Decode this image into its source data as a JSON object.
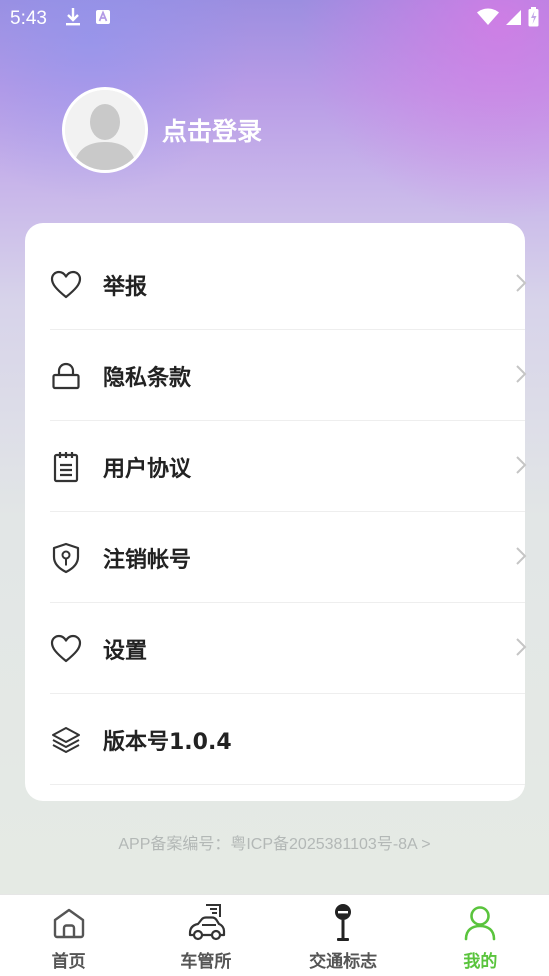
{
  "status_bar": {
    "time": "5:43",
    "left_icons": [
      "download-icon",
      "a-notification-icon"
    ],
    "right_icons": [
      "wifi-icon",
      "signal-icon",
      "battery-charging-icon"
    ]
  },
  "profile": {
    "login_text": "点击登录"
  },
  "menu": {
    "items": [
      {
        "label": "举报",
        "icon": "heart-icon",
        "has_chevron": true
      },
      {
        "label": "隐私条款",
        "icon": "lock-icon",
        "has_chevron": true
      },
      {
        "label": "用户协议",
        "icon": "notepad-icon",
        "has_chevron": true
      },
      {
        "label": "注销帐号",
        "icon": "shield-key-icon",
        "has_chevron": true
      },
      {
        "label": "设置",
        "icon": "heart-icon",
        "has_chevron": true
      },
      {
        "label": "版本号1.0.4",
        "icon": "layers-icon",
        "has_chevron": false
      }
    ]
  },
  "icp_text": "APP备案编号：粤ICP备2025381103号-8A >",
  "tabbar": {
    "tabs": [
      {
        "label": "首页",
        "icon": "home-icon",
        "active": false
      },
      {
        "label": "车管所",
        "icon": "car-icon",
        "active": false
      },
      {
        "label": "交通标志",
        "icon": "traffic-sign-icon",
        "active": false
      },
      {
        "label": "我的",
        "icon": "person-icon",
        "active": true
      }
    ],
    "active_color": "#5ac43d"
  },
  "colors": {
    "accent": "#5ac43d",
    "card_bg": "#ffffff",
    "text_primary": "#222222"
  }
}
